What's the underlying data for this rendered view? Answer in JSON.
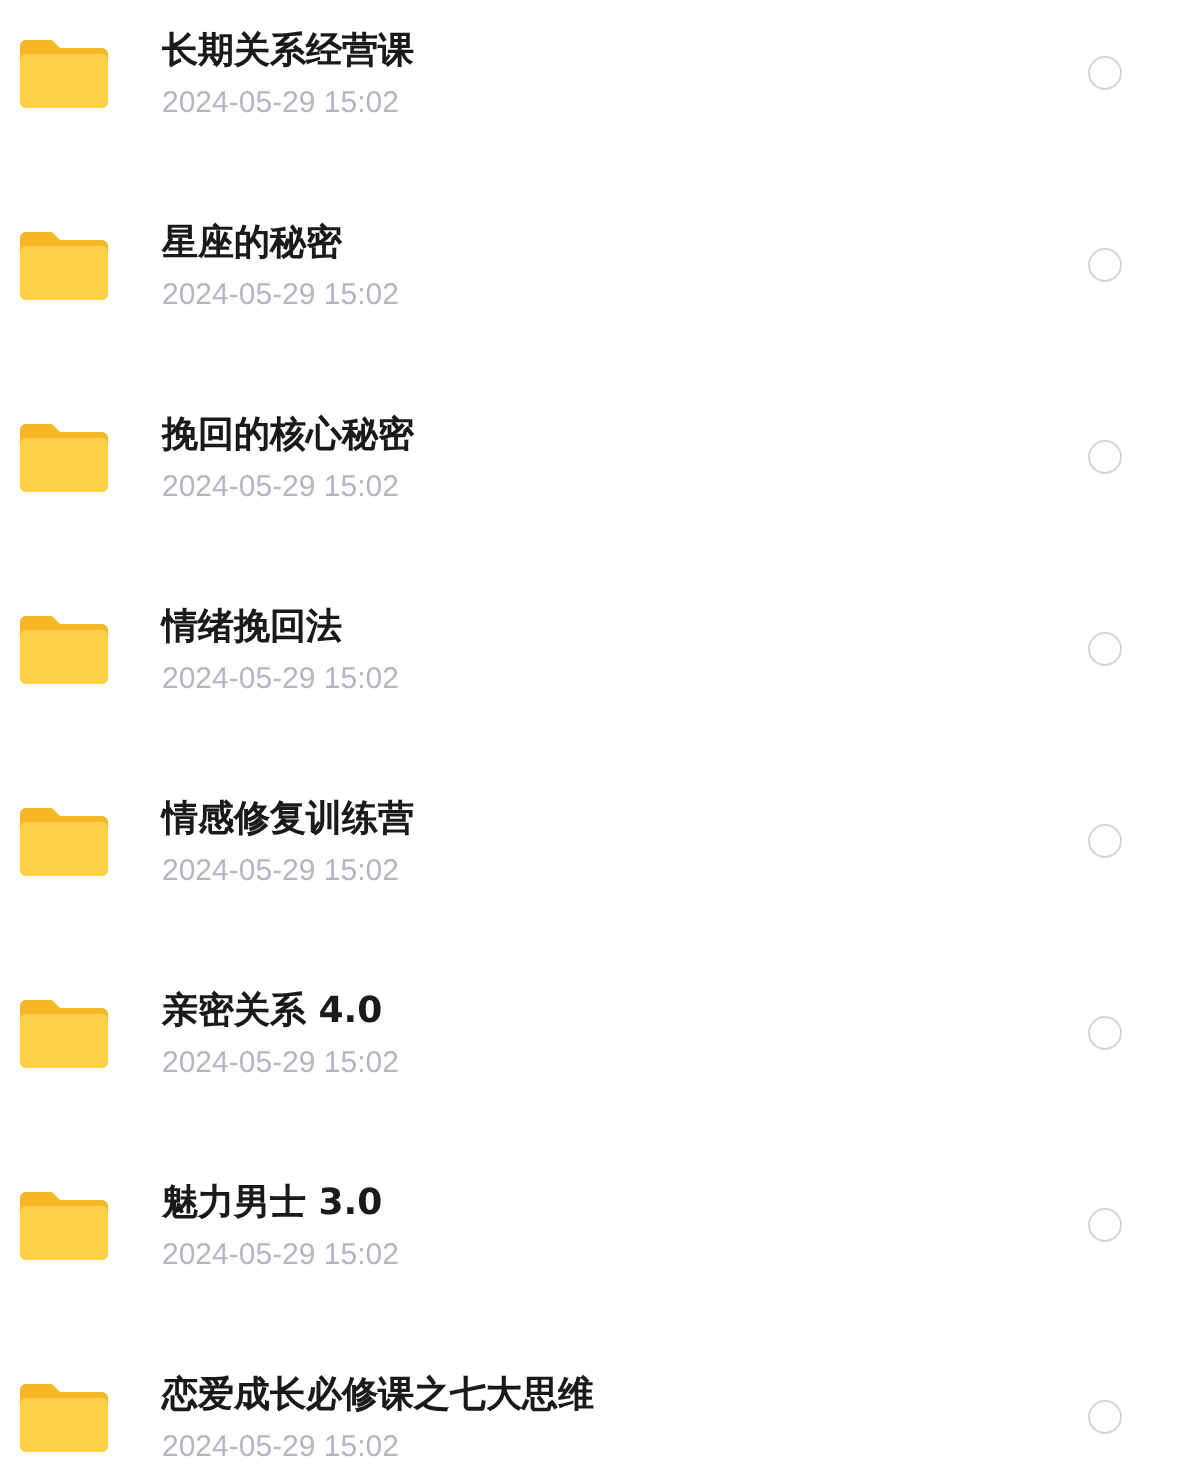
{
  "files": [
    {
      "name": "长期关系经营课",
      "date": "2024-05-29 15:02",
      "selected": false
    },
    {
      "name": "星座的秘密",
      "date": "2024-05-29 15:02",
      "selected": false
    },
    {
      "name": "挽回的核心秘密",
      "date": "2024-05-29 15:02",
      "selected": false
    },
    {
      "name": "情绪挽回法",
      "date": "2024-05-29 15:02",
      "selected": false
    },
    {
      "name": "情感修复训练营",
      "date": "2024-05-29 15:02",
      "selected": false
    },
    {
      "name": "亲密关系 4.0",
      "date": "2024-05-29 15:02",
      "selected": false
    },
    {
      "name": "魅力男士 3.0",
      "date": "2024-05-29 15:02",
      "selected": false
    },
    {
      "name": "恋爱成长必修课之七大思维",
      "date": "2024-05-29 15:02",
      "selected": false
    }
  ]
}
